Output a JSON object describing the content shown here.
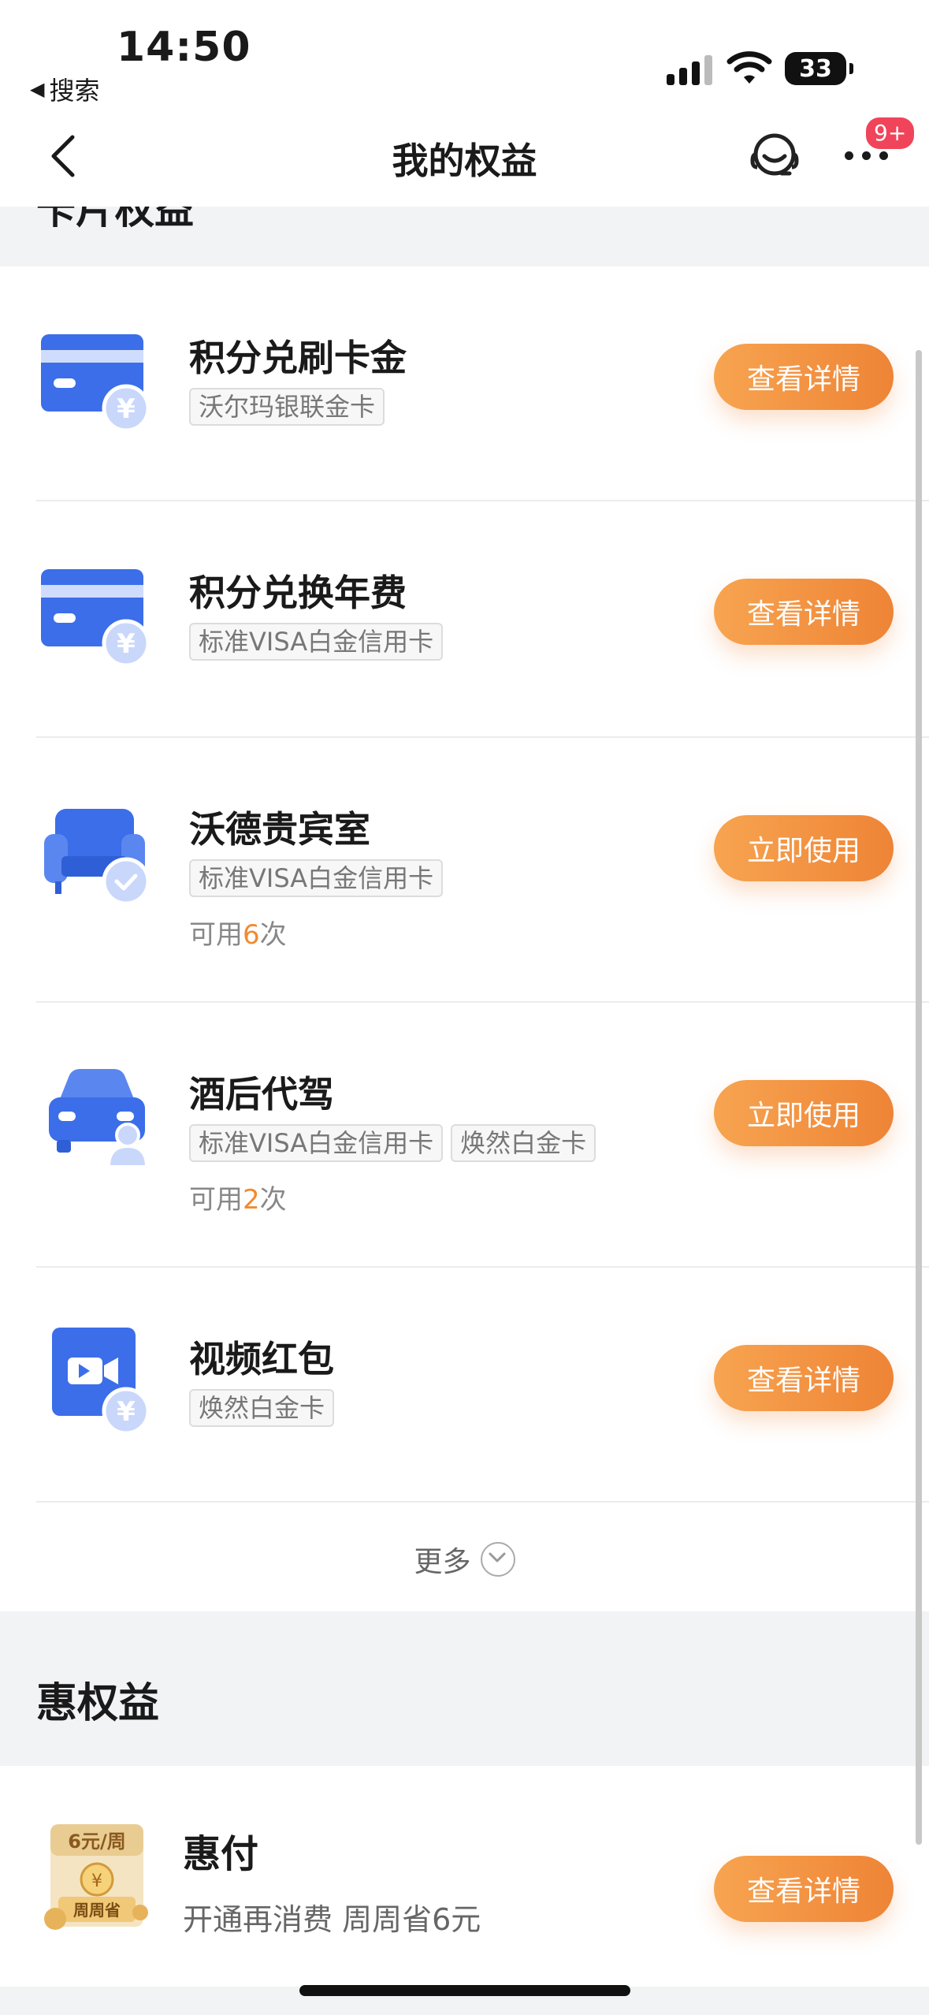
{
  "status_bar": {
    "time": "14:50",
    "back_app": "搜索",
    "battery": "33"
  },
  "nav": {
    "title": "我的权益",
    "badge": "9+"
  },
  "card_section": {
    "partial_title": "卡片权益",
    "items": [
      {
        "title": "积分兑刷卡金",
        "tags": [
          "沃尔玛银联金卡"
        ],
        "button": "查看详情",
        "icon": "card-yuan-icon"
      },
      {
        "title": "积分兑换年费",
        "tags": [
          "标准VISA白金信用卡"
        ],
        "button": "查看详情",
        "icon": "card-yuan-icon"
      },
      {
        "title": "沃德贵宾室",
        "tags": [
          "标准VISA白金信用卡"
        ],
        "avail_prefix": "可用",
        "avail_count": "6",
        "avail_suffix": "次",
        "button": "立即使用",
        "icon": "sofa-check-icon"
      },
      {
        "title": "酒后代驾",
        "tags": [
          "标准VISA白金信用卡",
          "焕然白金卡"
        ],
        "avail_prefix": "可用",
        "avail_count": "2",
        "avail_suffix": "次",
        "button": "立即使用",
        "icon": "car-driver-icon"
      },
      {
        "title": "视频红包",
        "tags": [
          "焕然白金卡"
        ],
        "button": "查看详情",
        "icon": "video-yuan-icon"
      }
    ],
    "more": "更多"
  },
  "hui_section": {
    "title": "惠权益",
    "item": {
      "title": "惠付",
      "desc": "开通再消费 周周省6元",
      "button": "查看详情",
      "icon_label_top": "6元/周",
      "icon_label_bottom": "周周省"
    }
  },
  "colors": {
    "accent": "#f28a2e",
    "button_start": "#f7a450",
    "button_end": "#ee8436",
    "badge": "#f0445a",
    "icon_blue": "#3b6ee8"
  }
}
